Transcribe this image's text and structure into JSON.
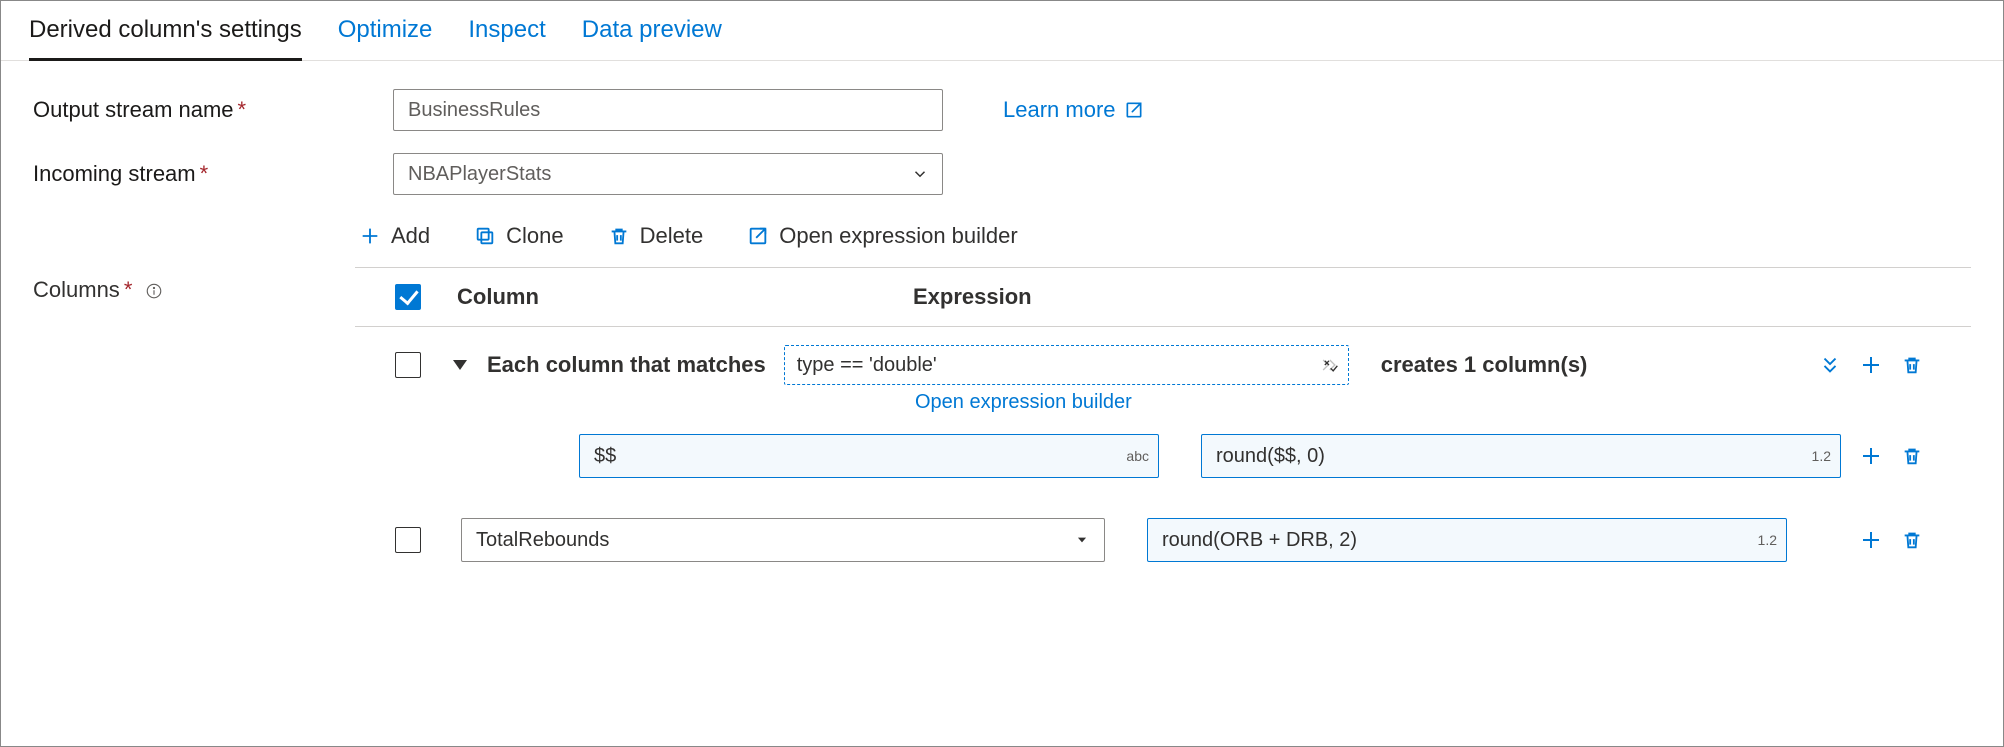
{
  "tabs": {
    "settings": "Derived column's settings",
    "optimize": "Optimize",
    "inspect": "Inspect",
    "preview": "Data preview"
  },
  "labels": {
    "output_stream": "Output stream name",
    "incoming_stream": "Incoming stream",
    "columns": "Columns",
    "learn_more": "Learn more"
  },
  "values": {
    "output_stream": "BusinessRules",
    "incoming_stream": "NBAPlayerStats"
  },
  "toolbar": {
    "add": "Add",
    "clone": "Clone",
    "delete": "Delete",
    "open_builder": "Open expression builder"
  },
  "table": {
    "header_column": "Column",
    "header_expression": "Expression",
    "rule1": {
      "prefix": "Each column that matches",
      "condition": "type == 'double'",
      "suffix": "creates 1 column(s)",
      "open_link": "Open expression builder",
      "col_name": "$$",
      "col_badge": "abc",
      "expr": "round($$, 0)",
      "expr_badge": "1.2"
    },
    "rule2": {
      "col_name": "TotalRebounds",
      "expr": "round(ORB + DRB, 2)",
      "expr_badge": "1.2"
    }
  }
}
